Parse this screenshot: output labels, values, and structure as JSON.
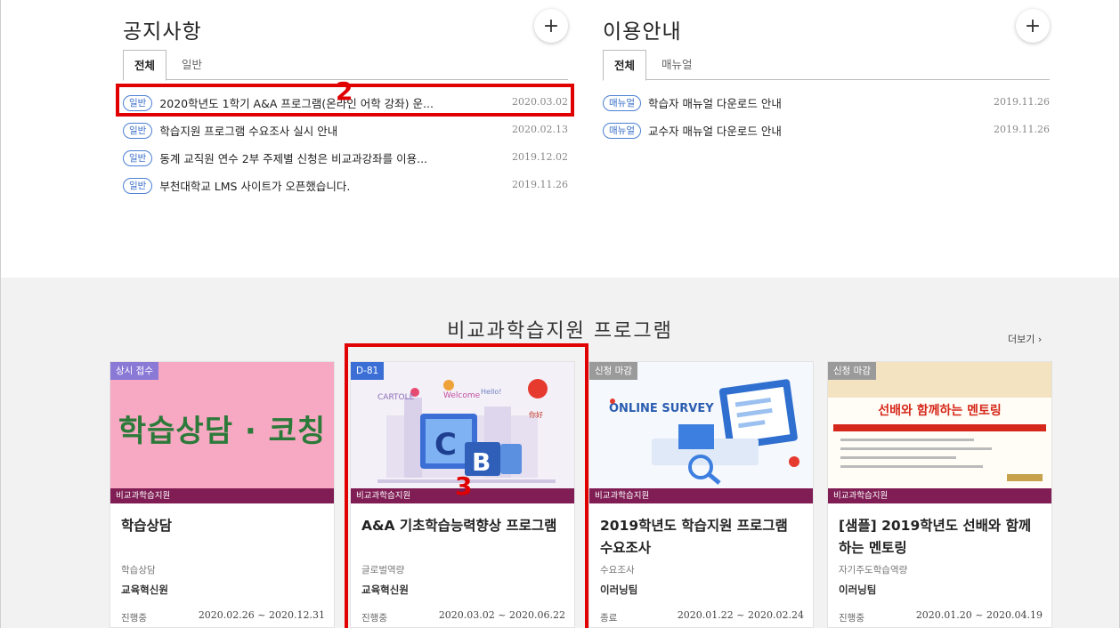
{
  "notice": {
    "title": "공지사항",
    "plus": "+",
    "tabs": [
      "전체",
      "일반"
    ],
    "items": [
      {
        "badge": "일반",
        "title": "2020학년도 1학기 A&A 프로그램(온라인 어학 강좌) 운...",
        "date": "2020.03.02"
      },
      {
        "badge": "일반",
        "title": "학습지원 프로그램 수요조사 실시 안내",
        "date": "2020.02.13"
      },
      {
        "badge": "일반",
        "title": "동계 교직원 연수 2부 주제별 신청은 비교과강좌를 이용...",
        "date": "2019.12.02"
      },
      {
        "badge": "일반",
        "title": "부천대학교 LMS 사이트가 오픈했습니다.",
        "date": "2019.11.26"
      }
    ]
  },
  "guide": {
    "title": "이용안내",
    "plus": "+",
    "tabs": [
      "전체",
      "매뉴얼"
    ],
    "items": [
      {
        "badge": "매뉴얼",
        "title": "학습자 매뉴얼 다운로드 안내",
        "date": "2019.11.26"
      },
      {
        "badge": "매뉴얼",
        "title": "교수자 매뉴얼 다운로드 안내",
        "date": "2019.11.26"
      }
    ]
  },
  "program": {
    "title": "비교과학습지원 프로그램",
    "more": "더보기 ›",
    "cards": [
      {
        "status": "상시 접수",
        "image_text": "학습상담 · 코칭",
        "category": "비교과학습지원",
        "title": "학습상담",
        "sub": "학습상담",
        "org": "교육혁신원",
        "state": "진행중",
        "period": "2020.02.26 ~ 2020.12.31"
      },
      {
        "status": "D-81",
        "image_text": "",
        "category": "비교과학습지원",
        "title": "A&A 기초학습능력향상 프로그램",
        "sub": "글로벌역량",
        "org": "교육혁신원",
        "state": "진행중",
        "period": "2020.03.02 ~ 2020.06.22"
      },
      {
        "status": "신청 마감",
        "image_text": "ONLINE SURVEY",
        "category": "비교과학습지원",
        "title": "2019학년도 학습지원 프로그램 수요조사",
        "sub": "수요조사",
        "org": "이러닝팀",
        "state": "종료",
        "period": "2020.01.22 ~ 2020.02.24"
      },
      {
        "status": "신청 마감",
        "image_text": "선배와 함께하는 멘토링",
        "category": "비교과학습지원",
        "title": "[샘플] 2019학년도 선배와 함께하는 멘토링",
        "sub": "자기주도학습역량",
        "org": "이러닝팀",
        "state": "진행중",
        "period": "2020.01.20 ~ 2020.04.19"
      }
    ]
  },
  "annotations": {
    "box_2_label": "2",
    "box_3_label": "3"
  },
  "colors": {
    "accent_badge": "#3a6fc9",
    "category_bar": "#7f1d54",
    "highlight": "#e00000",
    "card1_bg": "#f7a8c2",
    "card1_text": "#2c7a3a"
  }
}
